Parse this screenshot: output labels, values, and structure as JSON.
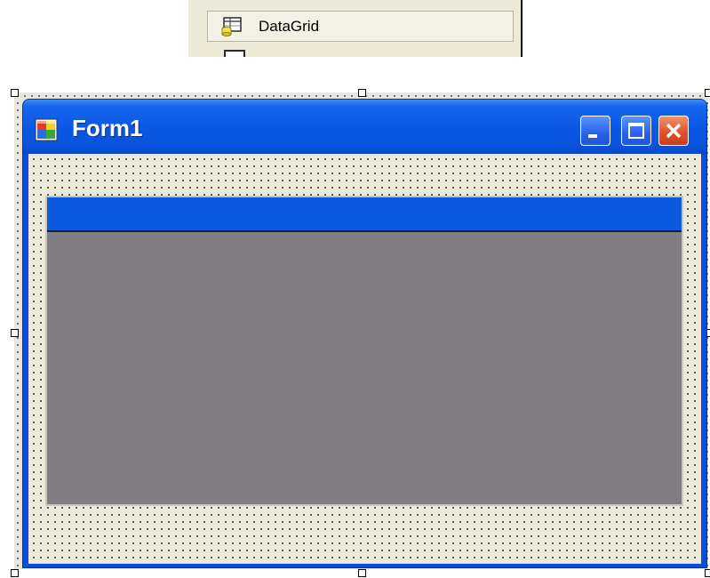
{
  "toolbox": {
    "selected_item_label": "DataGrid",
    "selected_item_icon": "datagrid-icon",
    "next_item_icon": "control-icon"
  },
  "form": {
    "title": "Form1",
    "title_icon": "form-app-icon",
    "controls": {
      "minimize": "minimize-icon",
      "maximize": "maximize-icon",
      "close": "close-icon"
    },
    "datagrid": {
      "caption_text": ""
    }
  },
  "colors": {
    "titlebar": "#0a57e4",
    "datagrid_caption": "#0b5ae0",
    "datagrid_background": "#807e82",
    "form_background": "#ece9d8"
  }
}
